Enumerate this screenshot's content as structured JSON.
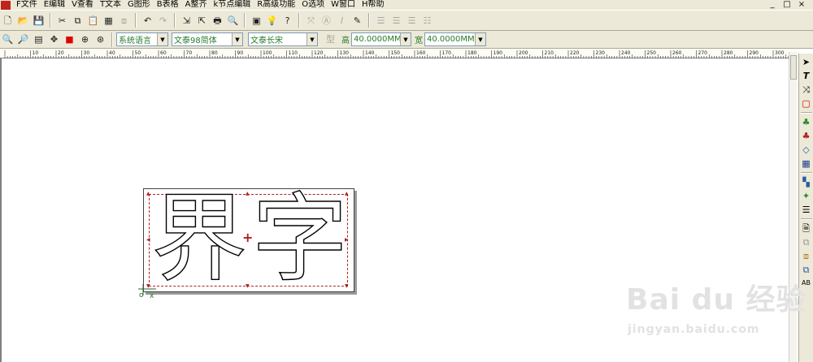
{
  "menu": {
    "items": [
      "F文件",
      "E编辑",
      "V查看",
      "T文本",
      "G图形",
      "B表格",
      "A整齐",
      "k节点编辑",
      "R高级功能",
      "O选项",
      "W窗口",
      "H帮助"
    ],
    "window_controls": [
      "_",
      "□",
      "×"
    ]
  },
  "toolbar2": {
    "language": "系统语言",
    "font_name": "文泰98简体",
    "font_style": "文泰长宋",
    "height_label": "高",
    "height_value": "40.0000MM",
    "width_label": "宽",
    "width_value": "40.0000MM"
  },
  "ruler": {
    "labels": [
      "10",
      "20",
      "30",
      "40",
      "50",
      "60",
      "70",
      "80",
      "90",
      "100",
      "110",
      "120",
      "130",
      "140",
      "150",
      "160",
      "170",
      "180",
      "190",
      "200",
      "210",
      "220",
      "230",
      "240",
      "250",
      "260",
      "270",
      "280",
      "290",
      "300",
      "310"
    ]
  },
  "canvas": {
    "glyph_1": "界",
    "glyph_2": "字",
    "origin_label": "o",
    "axis_label": "x"
  },
  "watermark": {
    "logo": "Bai du 经验",
    "url": "jingyan.baidu.com"
  },
  "colors": {
    "chrome": "#ece9d8",
    "selection": "#b02020",
    "combo_text": "#2a7a2a"
  }
}
